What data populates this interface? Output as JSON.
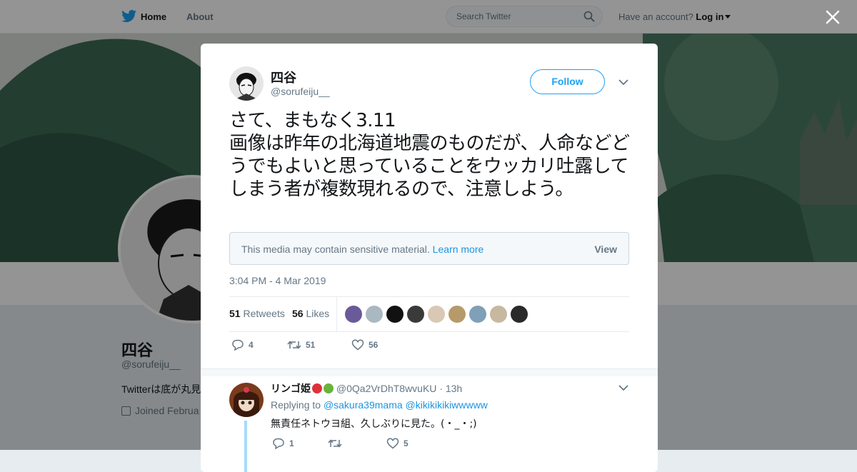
{
  "nav": {
    "home_label": "Home",
    "about_label": "About",
    "search_placeholder": "Search Twitter",
    "account_prompt": "Have an account?",
    "login_label": "Log in"
  },
  "profile": {
    "name": "四谷",
    "handle": "@sorufeiju__",
    "bio_partial": "Twitterは底が丸見",
    "joined_partial": "Joined Februa"
  },
  "tweet": {
    "author_name": "四谷",
    "author_handle": "@sorufeiju__",
    "follow_label": "Follow",
    "text": "さて、まもなく3.11\n画像は昨年の北海道地震のものだが、人命などどうでもよいと思っていることをウッカリ吐露してしまう者が複数現れるので、注意しよう。",
    "sensitive": {
      "message": "This media may contain sensitive material.",
      "learn_more": "Learn more",
      "view_label": "View"
    },
    "timestamp": "3:04 PM - 4 Mar 2019",
    "retweets_count": "51",
    "retweets_label": "Retweets",
    "likes_count": "56",
    "likes_label": "Likes",
    "liker_faces": [
      {
        "name": "liker-1",
        "color": "#6a5a9a"
      },
      {
        "name": "liker-2",
        "color": "#aab8c2"
      },
      {
        "name": "liker-3",
        "color": "#111111"
      },
      {
        "name": "liker-4",
        "color": "#3a3a3a"
      },
      {
        "name": "liker-5",
        "color": "#d9c8b4"
      },
      {
        "name": "liker-6",
        "color": "#b79a6a"
      },
      {
        "name": "liker-7",
        "color": "#7fa0b8"
      },
      {
        "name": "liker-8",
        "color": "#c8b8a0"
      },
      {
        "name": "liker-9",
        "color": "#2a2a2a"
      }
    ],
    "reply_count": "4",
    "retweet_action_count": "51",
    "like_action_count": "56"
  },
  "reply": {
    "name": "リンゴ姫",
    "handle": "@0Qa2VrDhT8wvuKU",
    "time": "· 13h",
    "replying_to_label": "Replying to",
    "replying_to": [
      "@sakura39mama",
      "@kikikikikiwwwww"
    ],
    "text": "無責任ネトウヨ組、久しぶりに見た。(・_・;)",
    "reply_count": "1",
    "like_count": "5"
  },
  "colors": {
    "accent": "#1da1f2",
    "link": "#1b95e0",
    "muted": "#657786",
    "text": "#14171a",
    "thread_line": "#a6dbfa"
  }
}
